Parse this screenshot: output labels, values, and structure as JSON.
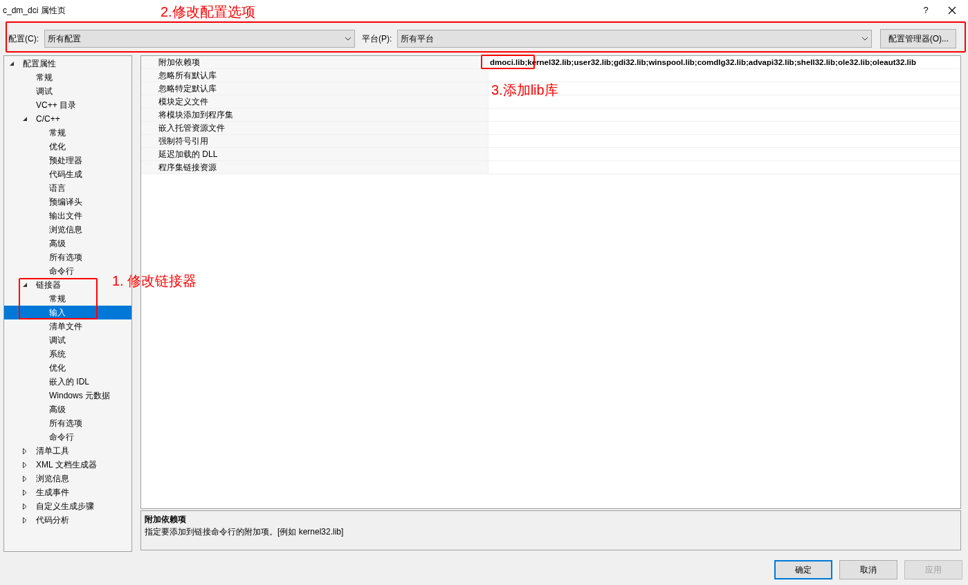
{
  "window": {
    "title": "c_dm_dci 属性页",
    "help": "?"
  },
  "config_bar": {
    "config_label": "配置(C):",
    "config_value": "所有配置",
    "platform_label": "平台(P):",
    "platform_value": "所有平台",
    "manager_button": "配置管理器(O)..."
  },
  "tree": [
    {
      "label": "配置属性",
      "expanded": true,
      "selected": false,
      "children": [
        {
          "label": "常规",
          "selected": false
        },
        {
          "label": "调试",
          "selected": false
        },
        {
          "label": "VC++ 目录",
          "selected": false
        },
        {
          "label": "C/C++",
          "expanded": true,
          "selected": false,
          "children": [
            {
              "label": "常规",
              "selected": false
            },
            {
              "label": "优化",
              "selected": false
            },
            {
              "label": "预处理器",
              "selected": false
            },
            {
              "label": "代码生成",
              "selected": false
            },
            {
              "label": "语言",
              "selected": false
            },
            {
              "label": "预编译头",
              "selected": false
            },
            {
              "label": "输出文件",
              "selected": false
            },
            {
              "label": "浏览信息",
              "selected": false
            },
            {
              "label": "高级",
              "selected": false
            },
            {
              "label": "所有选项",
              "selected": false
            },
            {
              "label": "命令行",
              "selected": false
            }
          ]
        },
        {
          "label": "链接器",
          "expanded": true,
          "selected": false,
          "children": [
            {
              "label": "常规",
              "selected": false
            },
            {
              "label": "输入",
              "selected": true
            },
            {
              "label": "清单文件",
              "selected": false
            },
            {
              "label": "调试",
              "selected": false
            },
            {
              "label": "系统",
              "selected": false
            },
            {
              "label": "优化",
              "selected": false
            },
            {
              "label": "嵌入的 IDL",
              "selected": false
            },
            {
              "label": "Windows 元数据",
              "selected": false
            },
            {
              "label": "高级",
              "selected": false
            },
            {
              "label": "所有选项",
              "selected": false
            },
            {
              "label": "命令行",
              "selected": false
            }
          ]
        },
        {
          "label": "清单工具",
          "expanded": false,
          "selected": false
        },
        {
          "label": "XML 文档生成器",
          "expanded": false,
          "selected": false
        },
        {
          "label": "浏览信息",
          "expanded": false,
          "selected": false
        },
        {
          "label": "生成事件",
          "expanded": false,
          "selected": false
        },
        {
          "label": "自定义生成步骤",
          "expanded": false,
          "selected": false
        },
        {
          "label": "代码分析",
          "expanded": false,
          "selected": false
        }
      ]
    }
  ],
  "properties": [
    {
      "name": "附加依赖项",
      "value": "dmoci.lib;kernel32.lib;user32.lib;gdi32.lib;winspool.lib;comdlg32.lib;advapi32.lib;shell32.lib;ole32.lib;oleaut32.lib"
    },
    {
      "name": "忽略所有默认库"
    },
    {
      "name": "忽略特定默认库"
    },
    {
      "name": "模块定义文件"
    },
    {
      "name": "将模块添加到程序集"
    },
    {
      "name": "嵌入托管资源文件"
    },
    {
      "name": "强制符号引用"
    },
    {
      "name": "延迟加载的 DLL"
    },
    {
      "name": "程序集链接资源"
    }
  ],
  "description": {
    "title": "附加依赖项",
    "text": "指定要添加到链接命令行的附加项。[例如 kernel32.lib]"
  },
  "buttons": [
    {
      "label": "确定",
      "kind": "default",
      "disabled": false
    },
    {
      "label": "取消",
      "kind": "normal",
      "disabled": false
    },
    {
      "label": "应用",
      "kind": "normal",
      "disabled": true
    }
  ],
  "annotations": [
    {
      "label": "2.修改配置选项",
      "kind": "config"
    },
    {
      "label": "1. 修改链接器",
      "kind": "linker"
    },
    {
      "label": "3.添加lib库",
      "kind": "lib"
    }
  ]
}
